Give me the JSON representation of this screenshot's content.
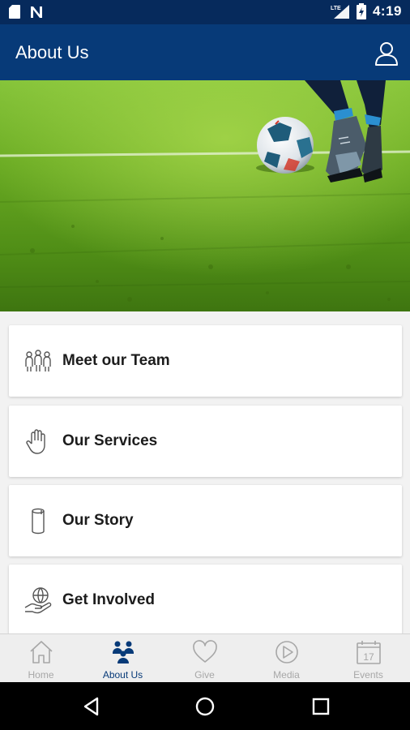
{
  "status_bar": {
    "time": "4:19",
    "network": "LTE",
    "background_color": "#062a5c"
  },
  "app_bar": {
    "title": "About Us",
    "background_color": "#073a78",
    "profile_icon": "user-outline-icon"
  },
  "hero": {
    "image_description_icon": "soccer-ball-on-grass-image"
  },
  "menu": {
    "items": [
      {
        "label": "Meet our Team",
        "icon": "people-group-icon"
      },
      {
        "label": "Our Services",
        "icon": "hand-icon"
      },
      {
        "label": "Our Story",
        "icon": "scroll-icon"
      },
      {
        "label": "Get Involved",
        "icon": "globe-in-hand-icon"
      }
    ]
  },
  "bottom_nav": {
    "active_color": "#073a78",
    "inactive_color": "#a7a7a7",
    "items": [
      {
        "label": "Home",
        "icon": "home-icon"
      },
      {
        "label": "About Us",
        "icon": "people-icon"
      },
      {
        "label": "Give",
        "icon": "heart-icon"
      },
      {
        "label": "Media",
        "icon": "play-circle-icon"
      },
      {
        "label": "Events",
        "icon": "calendar-icon",
        "calendar_day": "17"
      }
    ]
  }
}
